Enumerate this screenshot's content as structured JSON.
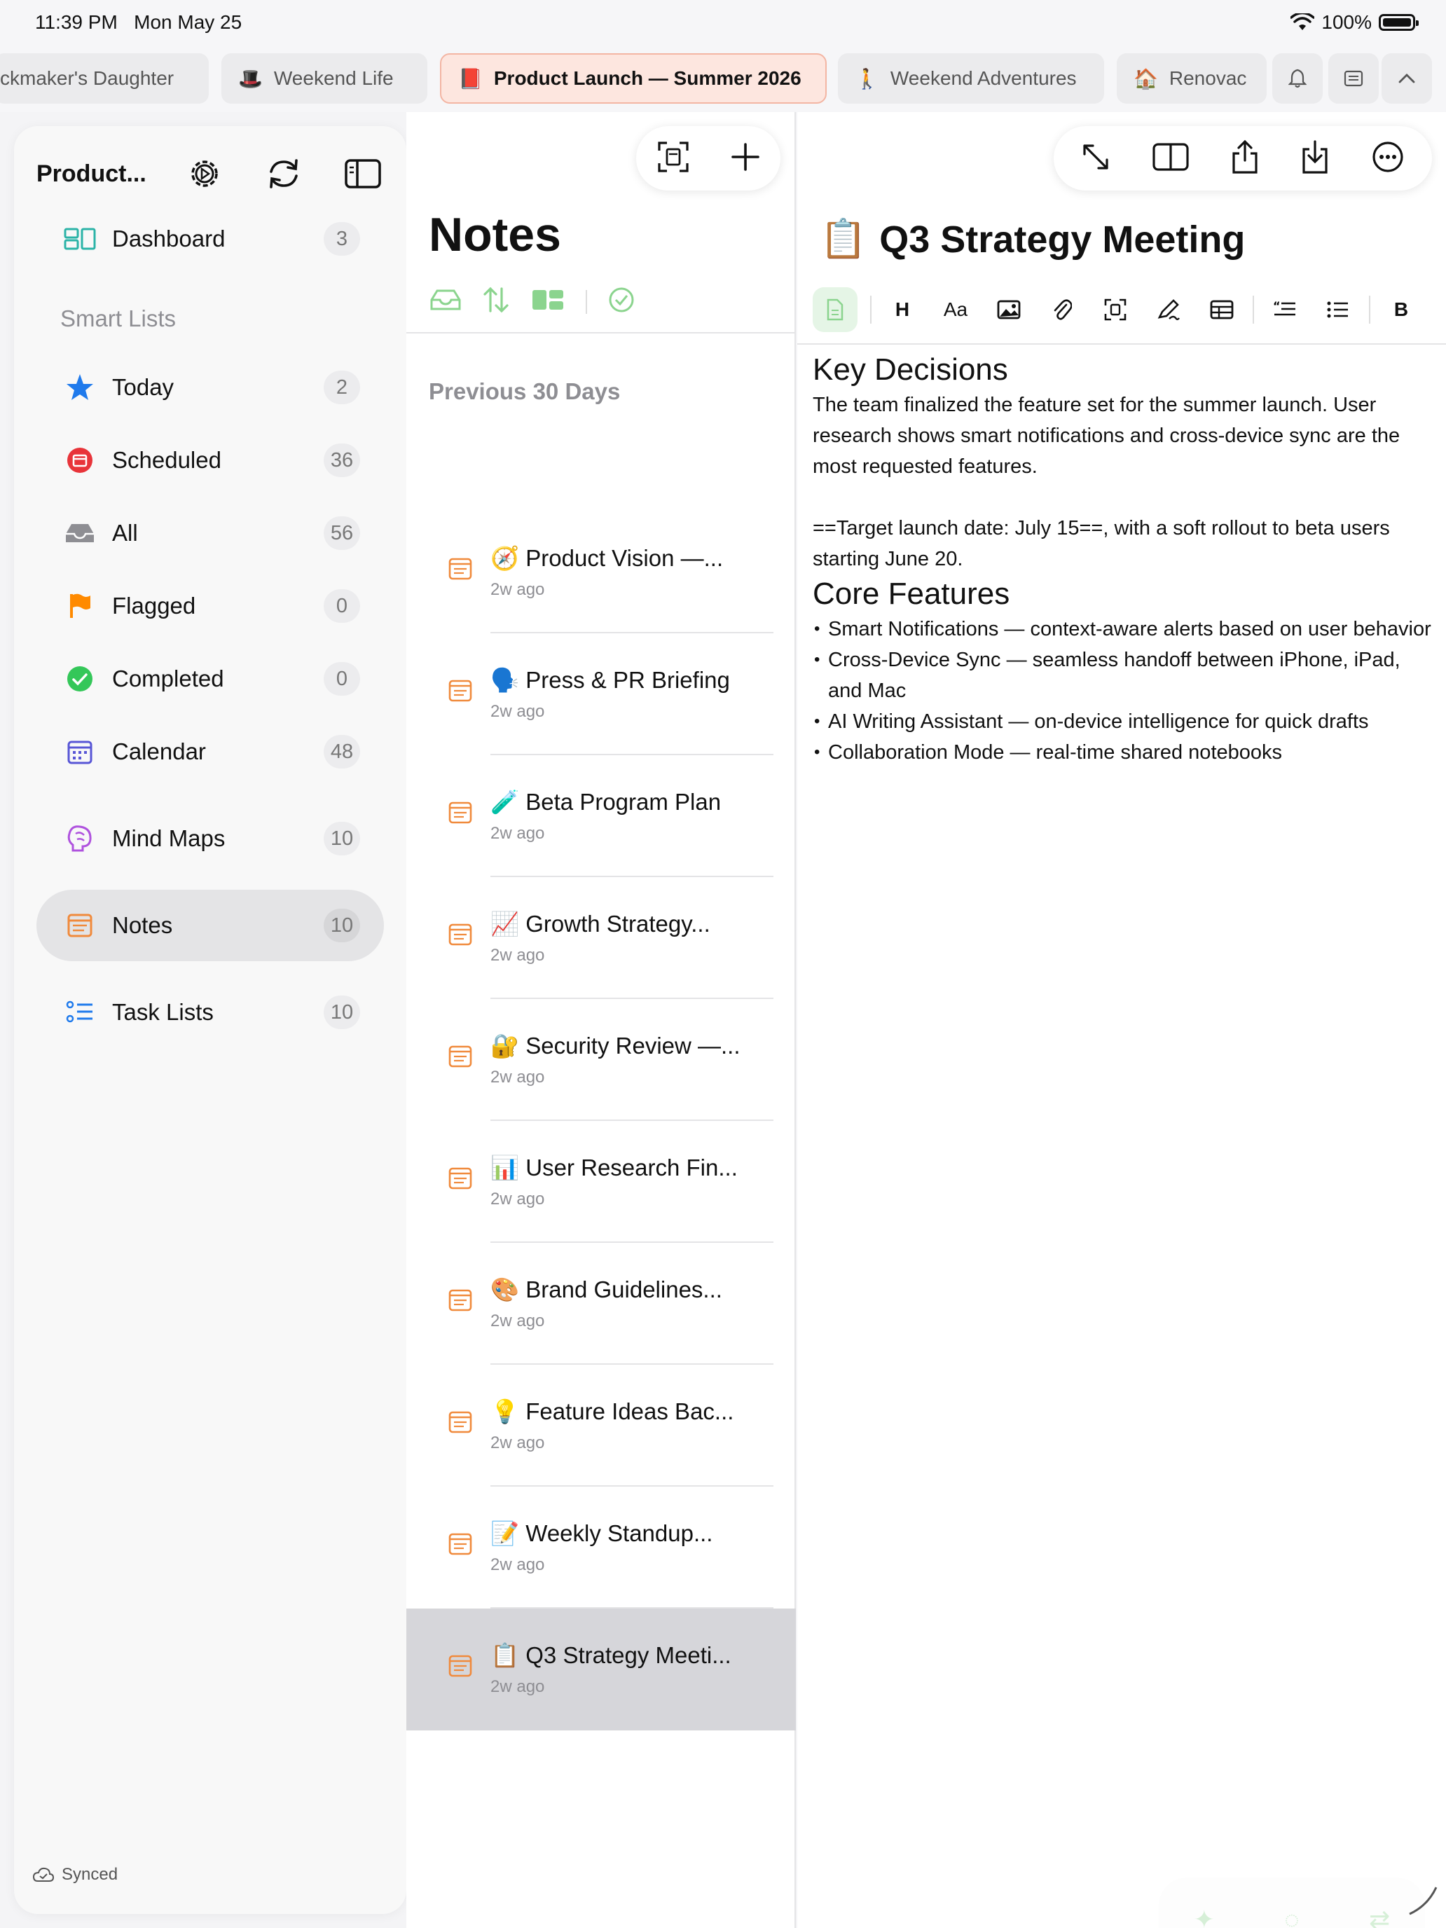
{
  "status": {
    "time": "11:39 PM",
    "date": "Mon May 25",
    "battery": "100%"
  },
  "tabs": [
    {
      "label": "ckmaker's Daughter"
    },
    {
      "label": "Weekend Life"
    },
    {
      "label": "Product Launch — Summer 2026"
    },
    {
      "label": "Weekend Adventures"
    },
    {
      "label": "Renovac"
    }
  ],
  "sidebar": {
    "title": "Product...",
    "dashboard": {
      "label": "Dashboard",
      "count": "3"
    },
    "section": "Smart Lists",
    "items": [
      {
        "label": "Today",
        "count": "2",
        "icon": "star-icon"
      },
      {
        "label": "Scheduled",
        "count": "36",
        "icon": "scheduled-icon"
      },
      {
        "label": "All",
        "count": "56",
        "icon": "tray-icon"
      },
      {
        "label": "Flagged",
        "count": "0",
        "icon": "flag-icon"
      },
      {
        "label": "Completed",
        "count": "0",
        "icon": "checkmark-icon"
      },
      {
        "label": "Calendar",
        "count": "48",
        "icon": "calendar-icon"
      }
    ],
    "mind_maps": {
      "label": "Mind Maps",
      "count": "10"
    },
    "notes": {
      "label": "Notes",
      "count": "10"
    },
    "task_lists": {
      "label": "Task Lists",
      "count": "10"
    },
    "synced": "Synced"
  },
  "notes_list": {
    "title": "Notes",
    "section": "Previous 30 Days",
    "items": [
      {
        "emoji": "🧭",
        "title": "Product Vision —...",
        "time": "2w ago"
      },
      {
        "emoji": "🗣️",
        "title": "Press & PR Briefing",
        "time": "2w ago"
      },
      {
        "emoji": "🧪",
        "title": "Beta Program Plan",
        "time": "2w ago"
      },
      {
        "emoji": "📈",
        "title": "Growth Strategy...",
        "time": "2w ago"
      },
      {
        "emoji": "🔐",
        "title": "Security Review —...",
        "time": "2w ago"
      },
      {
        "emoji": "📊",
        "title": "User Research Fin...",
        "time": "2w ago"
      },
      {
        "emoji": "🎨",
        "title": "Brand Guidelines...",
        "time": "2w ago"
      },
      {
        "emoji": "💡",
        "title": "Feature Ideas Bac...",
        "time": "2w ago"
      },
      {
        "emoji": "📝",
        "title": "Weekly Standup...",
        "time": "2w ago"
      },
      {
        "emoji": "📋",
        "title": "Q3 Strategy Meeti...",
        "time": "2w ago"
      }
    ]
  },
  "editor": {
    "title_emoji": "📋",
    "title": "Q3 Strategy Meeting",
    "heading1": "Key Decisions",
    "para1": "The team finalized the feature set for the summer launch. User research shows smart notifications and cross-device sync are the most requested features.",
    "para2": "==Target launch date: July 15==, with a soft rollout to beta users starting June 20.",
    "heading2": "Core Features",
    "bullets": [
      "Smart Notifications — context-aware alerts based on user behavior",
      "Cross-Device Sync — seamless handoff between iPhone, iPad, and Mac",
      "AI Writing Assistant — on-device intelligence for quick drafts",
      "Collaboration Mode — real-time shared notebooks"
    ],
    "format_bold": "B",
    "format_heading": "H",
    "format_text": "Aa"
  },
  "colors": {
    "accent": "#f08a3c",
    "selected_tab_bg": "#fde6df",
    "green": "#34c759"
  }
}
